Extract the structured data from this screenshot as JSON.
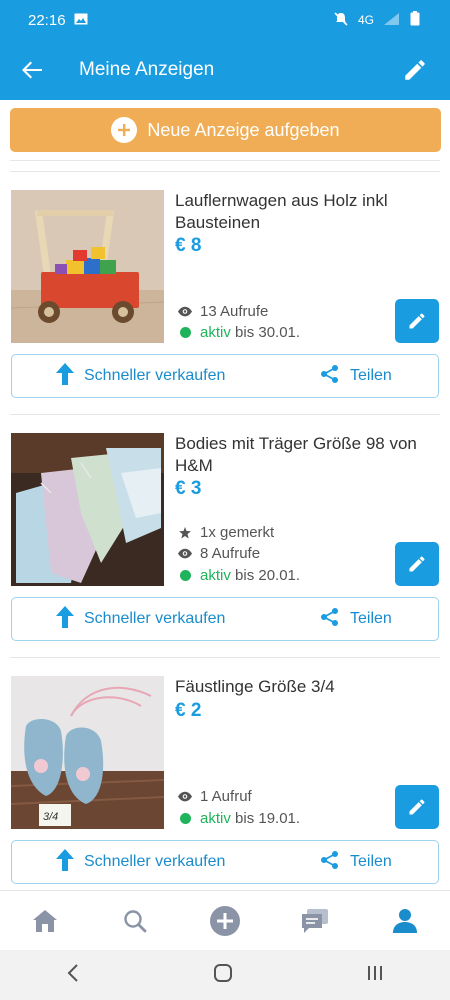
{
  "status": {
    "time": "22:16",
    "network": "4G"
  },
  "appbar": {
    "title": "Meine Anzeigen"
  },
  "new_ad_button": {
    "label": "Neue Anzeige aufgeben"
  },
  "colors": {
    "primary": "#1a9ce0",
    "accent": "#f0ad55",
    "active": "#1fb45b"
  },
  "listings": [
    {
      "title": "Lauflernwagen aus Holz inkl Bausteinen",
      "price": "€ 8",
      "views": "13 Aufrufe",
      "status_label": "aktiv",
      "status_until": "bis 30.01.",
      "sell_label": "Schneller verkaufen",
      "share_label": "Teilen"
    },
    {
      "title": "Bodies mit Träger Größe 98 von H&M",
      "price": "€ 3",
      "saved": "1x gemerkt",
      "views": "8 Aufrufe",
      "status_label": "aktiv",
      "status_until": "bis 20.01.",
      "sell_label": "Schneller verkaufen",
      "share_label": "Teilen"
    },
    {
      "title": "Fäustlinge Größe 3/4",
      "price": "€ 2",
      "views": "1 Aufruf",
      "status_label": "aktiv",
      "status_until": "bis 19.01.",
      "sell_label": "Schneller verkaufen",
      "share_label": "Teilen",
      "photo_note": "3/4"
    }
  ],
  "bottom_nav": [
    "home-icon",
    "search-icon",
    "add-circle-icon",
    "messages-icon",
    "profile-icon"
  ],
  "system_nav": [
    "back-icon",
    "home-circle-icon",
    "recents-icon"
  ]
}
